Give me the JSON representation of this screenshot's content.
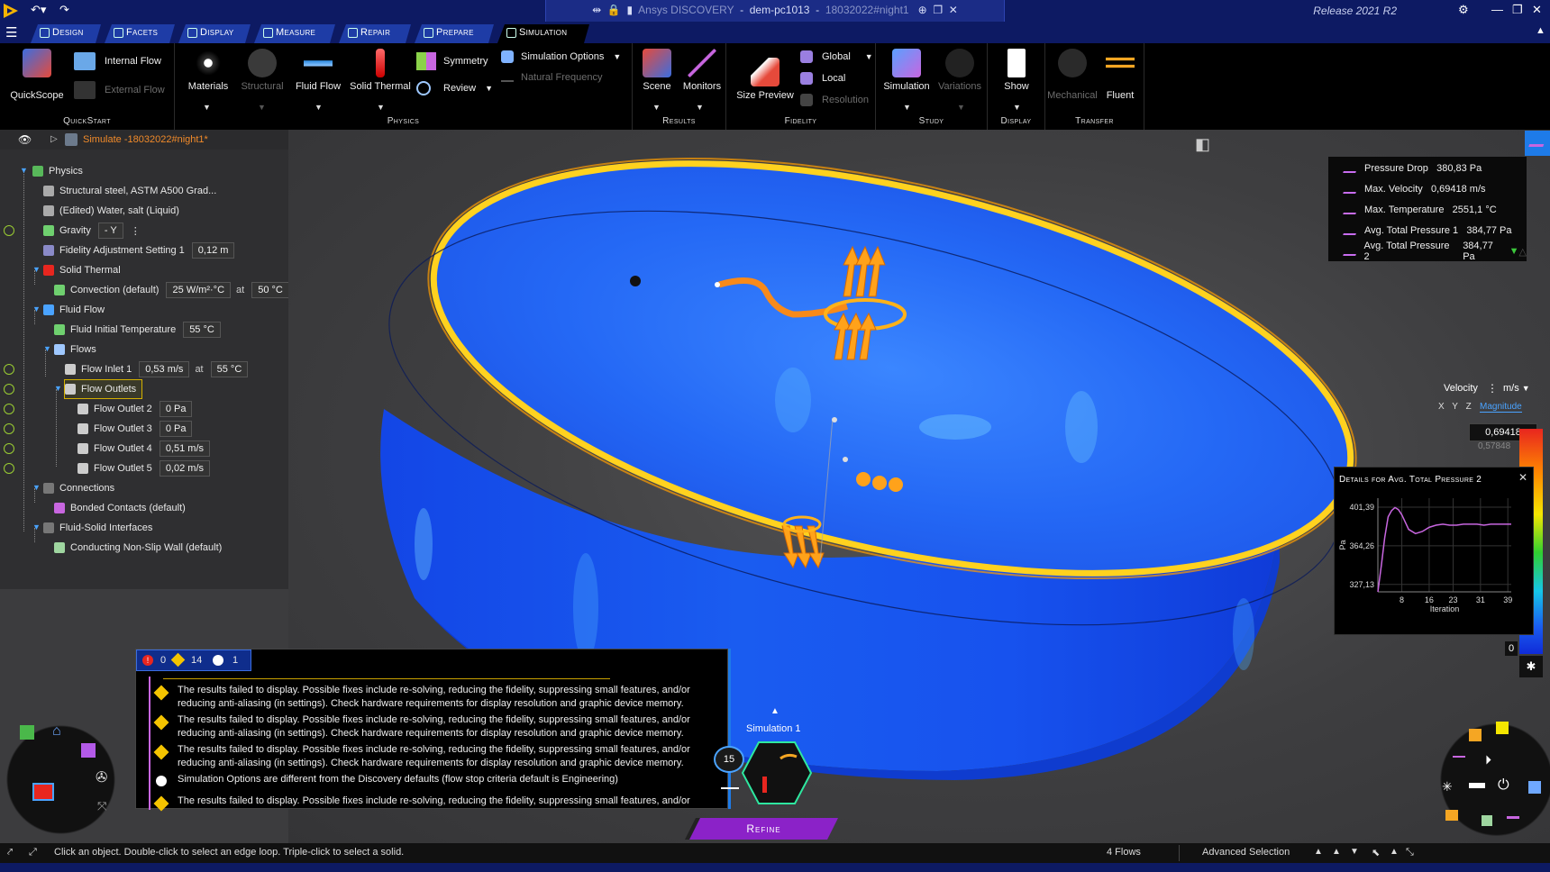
{
  "titlebar": {
    "app_title": "Ansys DISCOVERY",
    "host": "dem-pc1013",
    "doc": "18032022#night1",
    "release": "Release 2021 R2"
  },
  "tabs": [
    {
      "label": "Design",
      "active": false
    },
    {
      "label": "Facets",
      "active": false
    },
    {
      "label": "Display",
      "active": false
    },
    {
      "label": "Measure",
      "active": false
    },
    {
      "label": "Repair",
      "active": false
    },
    {
      "label": "Prepare",
      "active": false
    },
    {
      "label": "Simulation",
      "active": true
    }
  ],
  "ribbon": {
    "quickstart": {
      "group_label": "QuickStart",
      "quickscope": "QuickScope",
      "internal_flow": "Internal Flow",
      "external_flow": "External Flow"
    },
    "physics": {
      "group_label": "Physics",
      "materials": "Materials",
      "structural": "Structural",
      "fluid_flow": "Fluid Flow",
      "solid_thermal": "Solid Thermal",
      "symmetry": "Symmetry",
      "review": "Review",
      "simulation_options": "Simulation Options",
      "natural_frequency": "Natural Frequency"
    },
    "results": {
      "group_label": "Results",
      "scene": "Scene",
      "monitors": "Monitors"
    },
    "fidelity": {
      "group_label": "Fidelity",
      "size_preview": "Size Preview",
      "global": "Global",
      "local": "Local",
      "resolution": "Resolution"
    },
    "study": {
      "group_label": "Study",
      "simulation": "Simulation",
      "variations": "Variations"
    },
    "display": {
      "group_label": "Display",
      "show": "Show"
    },
    "transfer": {
      "group_label": "Transfer",
      "mechanical": "Mechanical",
      "fluent": "Fluent"
    }
  },
  "tree": {
    "root": "Simulate -18032022#night1*",
    "items": [
      {
        "label": "Physics"
      },
      {
        "label": "Structural steel, ASTM A500 Grad..."
      },
      {
        "label": "(Edited) Water, salt (Liquid)"
      },
      {
        "label": "Gravity",
        "value": "- Y"
      },
      {
        "label": "Fidelity Adjustment Setting 1",
        "value": "0,12 m"
      },
      {
        "label": "Solid Thermal"
      },
      {
        "label": "Convection (default)",
        "value": "25 W/m²·°C",
        "at": "at",
        "value2": "50 °C"
      },
      {
        "label": "Fluid Flow"
      },
      {
        "label": "Fluid Initial Temperature",
        "value": "55 °C"
      },
      {
        "label": "Flows"
      },
      {
        "label": "Flow Inlet 1",
        "value": "0,53 m/s",
        "at": "at",
        "value2": "55 °C"
      },
      {
        "label": "Flow Outlets"
      },
      {
        "label": "Flow Outlet 2",
        "value": "0 Pa"
      },
      {
        "label": "Flow Outlet 3",
        "value": "0 Pa"
      },
      {
        "label": "Flow Outlet 4",
        "value": "0,51 m/s"
      },
      {
        "label": "Flow Outlet 5",
        "value": "0,02 m/s"
      },
      {
        "label": "Connections"
      },
      {
        "label": "Bonded Contacts (default)"
      },
      {
        "label": "Fluid-Solid Interfaces"
      },
      {
        "label": "Conducting Non-Slip Wall (default)"
      }
    ]
  },
  "monitors": [
    {
      "name": "Pressure Drop",
      "value": "380,83 Pa"
    },
    {
      "name": "Max. Velocity",
      "value": "0,69418 m/s"
    },
    {
      "name": "Max. Temperature",
      "value": "2551,1 °C"
    },
    {
      "name": "Avg. Total Pressure 1",
      "value": "384,77 Pa"
    },
    {
      "name": "Avg. Total Pressure 2",
      "value": "384,77 Pa"
    }
  ],
  "legend": {
    "quantity": "Velocity",
    "unit": "m/s",
    "axes": [
      "X",
      "Y",
      "Z"
    ],
    "mode": "Magnitude",
    "max": "0,69418",
    "second": "0,57848",
    "min": "0"
  },
  "details": {
    "title": "Details for Avg. Total Pressure 2",
    "ylabel": "Pa",
    "xlabel": "Iteration",
    "yticks": [
      "401,39",
      "364,26",
      "327,13"
    ],
    "xticks": [
      "8",
      "16",
      "23",
      "31",
      "39"
    ]
  },
  "chart_data": {
    "type": "line",
    "title": "Details for Avg. Total Pressure 2",
    "xlabel": "Iteration",
    "ylabel": "Pa",
    "ylim": [
      320,
      410
    ],
    "xlim": [
      1,
      40
    ],
    "series": [
      {
        "x": [
          1,
          2,
          3,
          4,
          5,
          6,
          7,
          8,
          9,
          10,
          12,
          14,
          16,
          18,
          20,
          22,
          24,
          26,
          28,
          30,
          32,
          34,
          36,
          38,
          40
        ],
        "values": [
          320,
          345,
          372,
          392,
          398,
          401,
          399,
          394,
          387,
          380,
          376,
          378,
          382,
          384,
          385,
          384,
          384,
          385,
          385,
          385,
          384,
          385,
          385,
          385,
          385
        ]
      }
    ]
  },
  "log": {
    "errors": "0",
    "warnings": "14",
    "infos": "1",
    "messages": [
      {
        "type": "warning",
        "text": "The results failed to display. Possible fixes include re-solving, reducing the fidelity, suppressing small features, and/or reducing anti-aliasing (in settings). Check hardware requirements for display resolution and graphic device memory."
      },
      {
        "type": "warning",
        "text": "The results failed to display. Possible fixes include re-solving, reducing the fidelity, suppressing small features, and/or reducing anti-aliasing (in settings). Check hardware requirements for display resolution and graphic device memory."
      },
      {
        "type": "warning",
        "text": "The results failed to display. Possible fixes include re-solving, reducing the fidelity, suppressing small features, and/or reducing anti-aliasing (in settings). Check hardware requirements for display resolution and graphic device memory."
      },
      {
        "type": "info",
        "text": "Simulation Options are different from the Discovery defaults (flow stop criteria default is Engineering)"
      },
      {
        "type": "warning",
        "text": "The results failed to display. Possible fixes include re-solving, reducing the fidelity, suppressing small features, and/or"
      }
    ]
  },
  "simulation_hud": {
    "label": "Simulation 1",
    "count": "15",
    "refine": "Refine"
  },
  "status": {
    "hint": "Click an object. Double-click to select an edge loop. Triple-click to select a solid.",
    "flows": "4 Flows",
    "selection": "Advanced Selection"
  },
  "colors": {
    "accent": "#0d1a63",
    "tab": "#1e3ca6",
    "refine": "#8b22c8",
    "tree_root": "#f08a2a"
  }
}
